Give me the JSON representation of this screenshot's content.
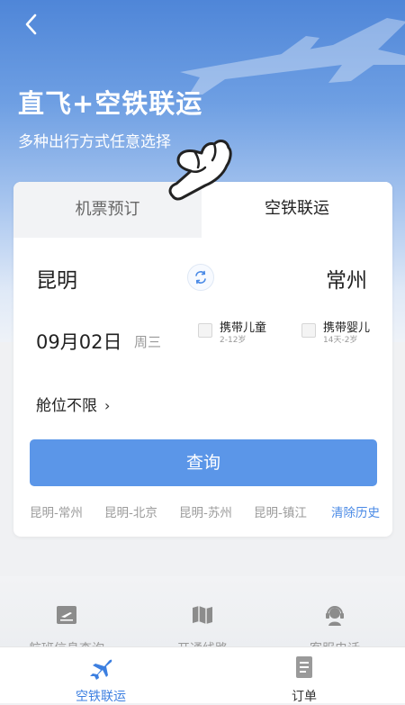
{
  "header": {
    "title": "直飞+空铁联运",
    "subtitle": "多种出行方式任意选择"
  },
  "tabs": [
    {
      "label": "机票预订",
      "active": false
    },
    {
      "label": "空铁联运",
      "active": true
    }
  ],
  "route": {
    "from": "昆明",
    "to": "常州"
  },
  "date": {
    "value": "09月02日",
    "weekday": "周三"
  },
  "options": {
    "child": {
      "label": "携带儿童",
      "sub": "2-12岁"
    },
    "infant": {
      "label": "携带婴儿",
      "sub": "14天-2岁"
    }
  },
  "cabin": {
    "label": "舱位不限",
    "arrow": "›"
  },
  "query_button": "查询",
  "history": {
    "items": [
      "昆明-常州",
      "昆明-北京",
      "昆明-苏州",
      "昆明-镇江"
    ],
    "clear": "清除历史"
  },
  "services": [
    {
      "label": "航班信息查询",
      "icon": "flight-ticket-icon"
    },
    {
      "label": "开通线路",
      "icon": "map-icon"
    },
    {
      "label": "客服电话",
      "icon": "headset-icon"
    }
  ],
  "bottom_nav": [
    {
      "label": "空铁联运",
      "icon": "airplane-icon",
      "active": true
    },
    {
      "label": "订单",
      "icon": "document-icon",
      "active": false
    }
  ],
  "colors": {
    "accent": "#5b96e8",
    "active_tab_text": "#3c7fe0",
    "hero_top": "#4f86d8"
  }
}
